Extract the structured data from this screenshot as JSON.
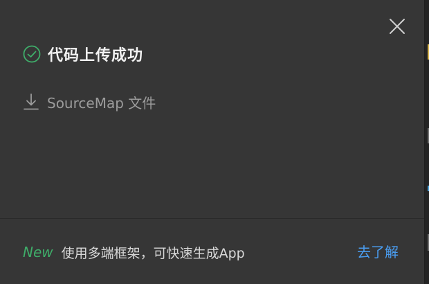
{
  "dialog": {
    "title": "代码上传成功",
    "download_label": "SourceMap 文件",
    "footer": {
      "badge": "New",
      "message": "使用多端框架，可快速生成App",
      "link_label": "去了解"
    }
  },
  "icons": {
    "status": "check-circle-icon",
    "download": "download-icon",
    "close": "close-icon"
  },
  "colors": {
    "background": "#363636",
    "success": "#3fae6a",
    "link": "#4a9df0",
    "title": "#f2f2f2",
    "muted": "#9c9c9c"
  }
}
